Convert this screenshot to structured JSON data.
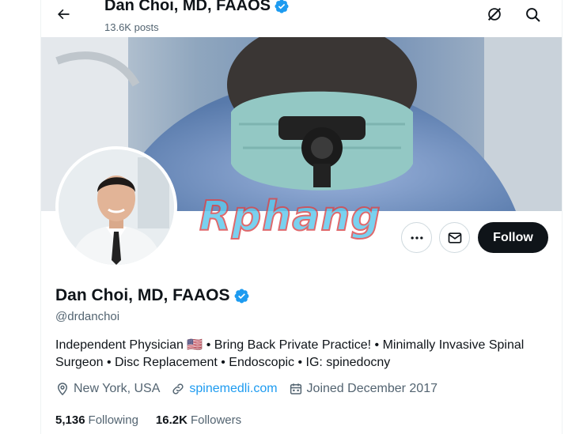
{
  "header": {
    "title": "Dan Choi, MD, FAAOS",
    "posts_count": "13.6K posts"
  },
  "watermark": {
    "text": "Rphang"
  },
  "actions": {
    "follow_label": "Follow"
  },
  "profile": {
    "name": "Dan Choi, MD, FAAOS",
    "handle": "@drdanchoi",
    "bio_part1": "Independent Physician",
    "flag": "🇺🇸",
    "bio_part2": "• Bring Back Private Practice! • Minimally Invasive Spinal Surgeon • Disc Replacement • Endoscopic • IG: spinedocny",
    "location": "New York, USA",
    "website": "spinemedli.com",
    "joined": "Joined December 2017"
  },
  "stats": {
    "following_count": "5,136",
    "following_label": "Following",
    "followers_count": "16.2K",
    "followers_label": "Followers"
  },
  "colors": {
    "verified": "#1d9bf0",
    "link": "#1d9bf0",
    "follow_bg": "#0f1419",
    "secondary_text": "#536471"
  },
  "icons": [
    "back-arrow-icon",
    "verified-badge-icon",
    "grok-icon",
    "search-icon",
    "more-icon",
    "mail-icon",
    "location-icon",
    "link-icon",
    "calendar-icon"
  ]
}
